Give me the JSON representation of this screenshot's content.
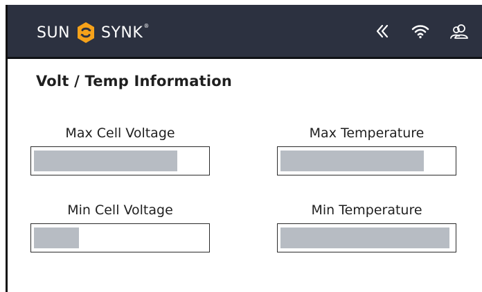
{
  "header": {
    "brand": {
      "left": "SUN",
      "right": "SYNK",
      "registered": "®"
    },
    "icons": [
      "double-chevron-left-icon",
      "wifi-icon",
      "users-icon"
    ]
  },
  "main": {
    "title": "Volt / Temp Information",
    "metrics": [
      {
        "label": "Max Cell Voltage",
        "level": 0.83
      },
      {
        "label": "Max Temperature",
        "level": 0.83
      },
      {
        "label": "Min Cell Voltage",
        "level": 0.26
      },
      {
        "label": "Min Temperature",
        "level": 0.98
      }
    ]
  },
  "colors": {
    "header_bg": "#2c3140",
    "accent": "#f6a21a",
    "bar_fill": "#b7bcc3",
    "text": "#1f1f1f"
  }
}
